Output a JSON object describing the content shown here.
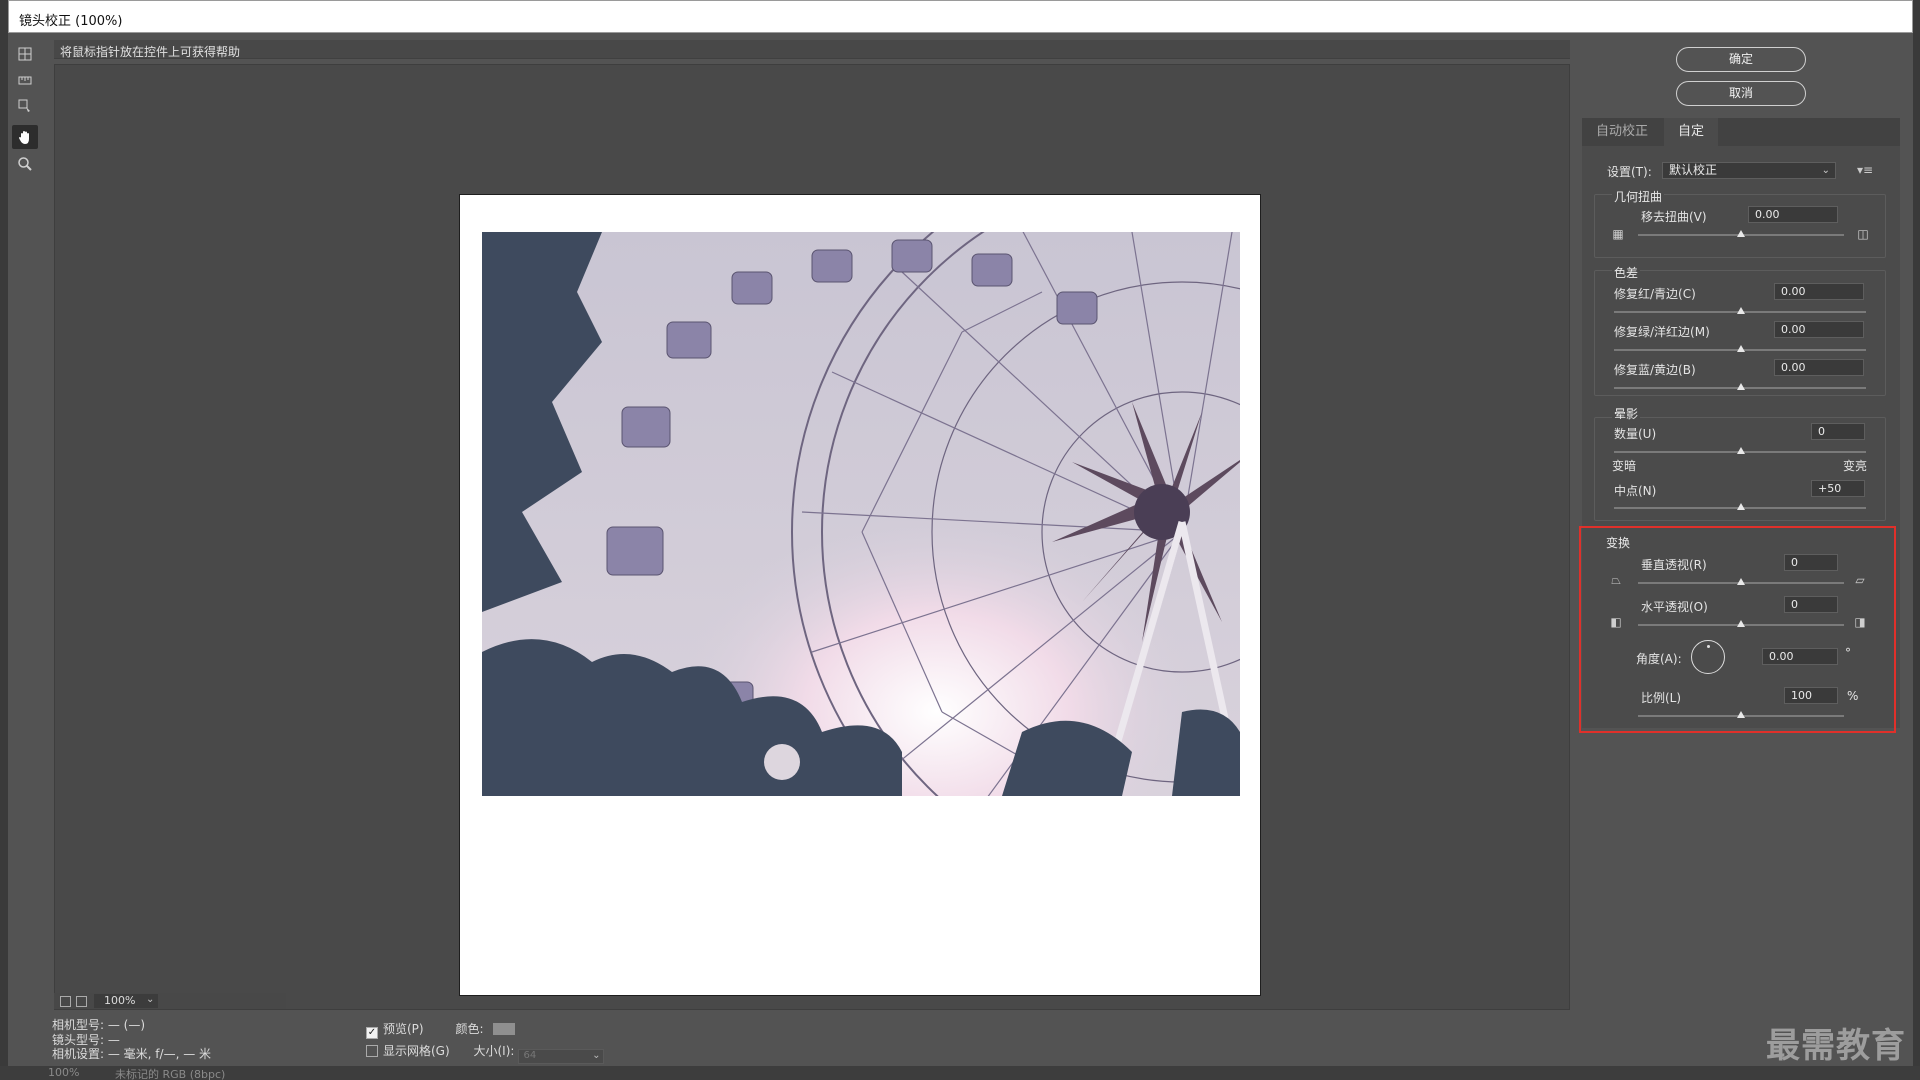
{
  "window": {
    "title": "镜头校正 (100%)"
  },
  "help_text": "将鼠标指针放在控件上可获得帮助",
  "buttons": {
    "ok": "确定",
    "cancel": "取消"
  },
  "tabs": [
    {
      "label": "自动校正",
      "active": false
    },
    {
      "label": "自定",
      "active": true
    }
  ],
  "settings": {
    "label": "设置(T):",
    "value": "默认校正"
  },
  "geometric": {
    "title": "几何扭曲",
    "remove_distortion": {
      "label": "移去扭曲(V)",
      "value": "0.00"
    }
  },
  "chromatic": {
    "title": "色差",
    "red_cyan": {
      "label": "修复红/青边(C)",
      "value": "0.00"
    },
    "green_magenta": {
      "label": "修复绿/洋红边(M)",
      "value": "0.00"
    },
    "blue_yellow": {
      "label": "修复蓝/黄边(B)",
      "value": "0.00"
    }
  },
  "vignette": {
    "title": "晕影",
    "amount": {
      "label": "数量(U)",
      "value": "0"
    },
    "darken": "变暗",
    "lighten": "变亮",
    "midpoint": {
      "label": "中点(N)",
      "value": "+50"
    }
  },
  "transform": {
    "title": "变换",
    "vertical": {
      "label": "垂直透视(R)",
      "value": "0"
    },
    "horizontal": {
      "label": "水平透视(O)",
      "value": "0"
    },
    "angle": {
      "label": "角度(A):",
      "value": "0.00",
      "unit": "°"
    },
    "scale": {
      "label": "比例(L)",
      "value": "100",
      "unit": "%"
    }
  },
  "zoom": {
    "value": "100%"
  },
  "camera_info": {
    "camera_model": "相机型号: — (—)",
    "lens_model": "镜头型号: —",
    "camera_settings": "相机设置: — 毫米, f/—, — 米"
  },
  "options": {
    "preview": {
      "label": "预览(P)",
      "checked": true
    },
    "show_grid": {
      "label": "显示网格(G)",
      "checked": false
    },
    "color_label": "颜色:",
    "size_label": "大小(I):",
    "size_value": "64"
  },
  "status": {
    "zoom": "100%",
    "info": "未标记的 RGB (8bpc)"
  },
  "watermark": "最需教育",
  "colors": {
    "highlight": "#e0302a",
    "panel": "#4b4b4b",
    "background": "#535353"
  }
}
